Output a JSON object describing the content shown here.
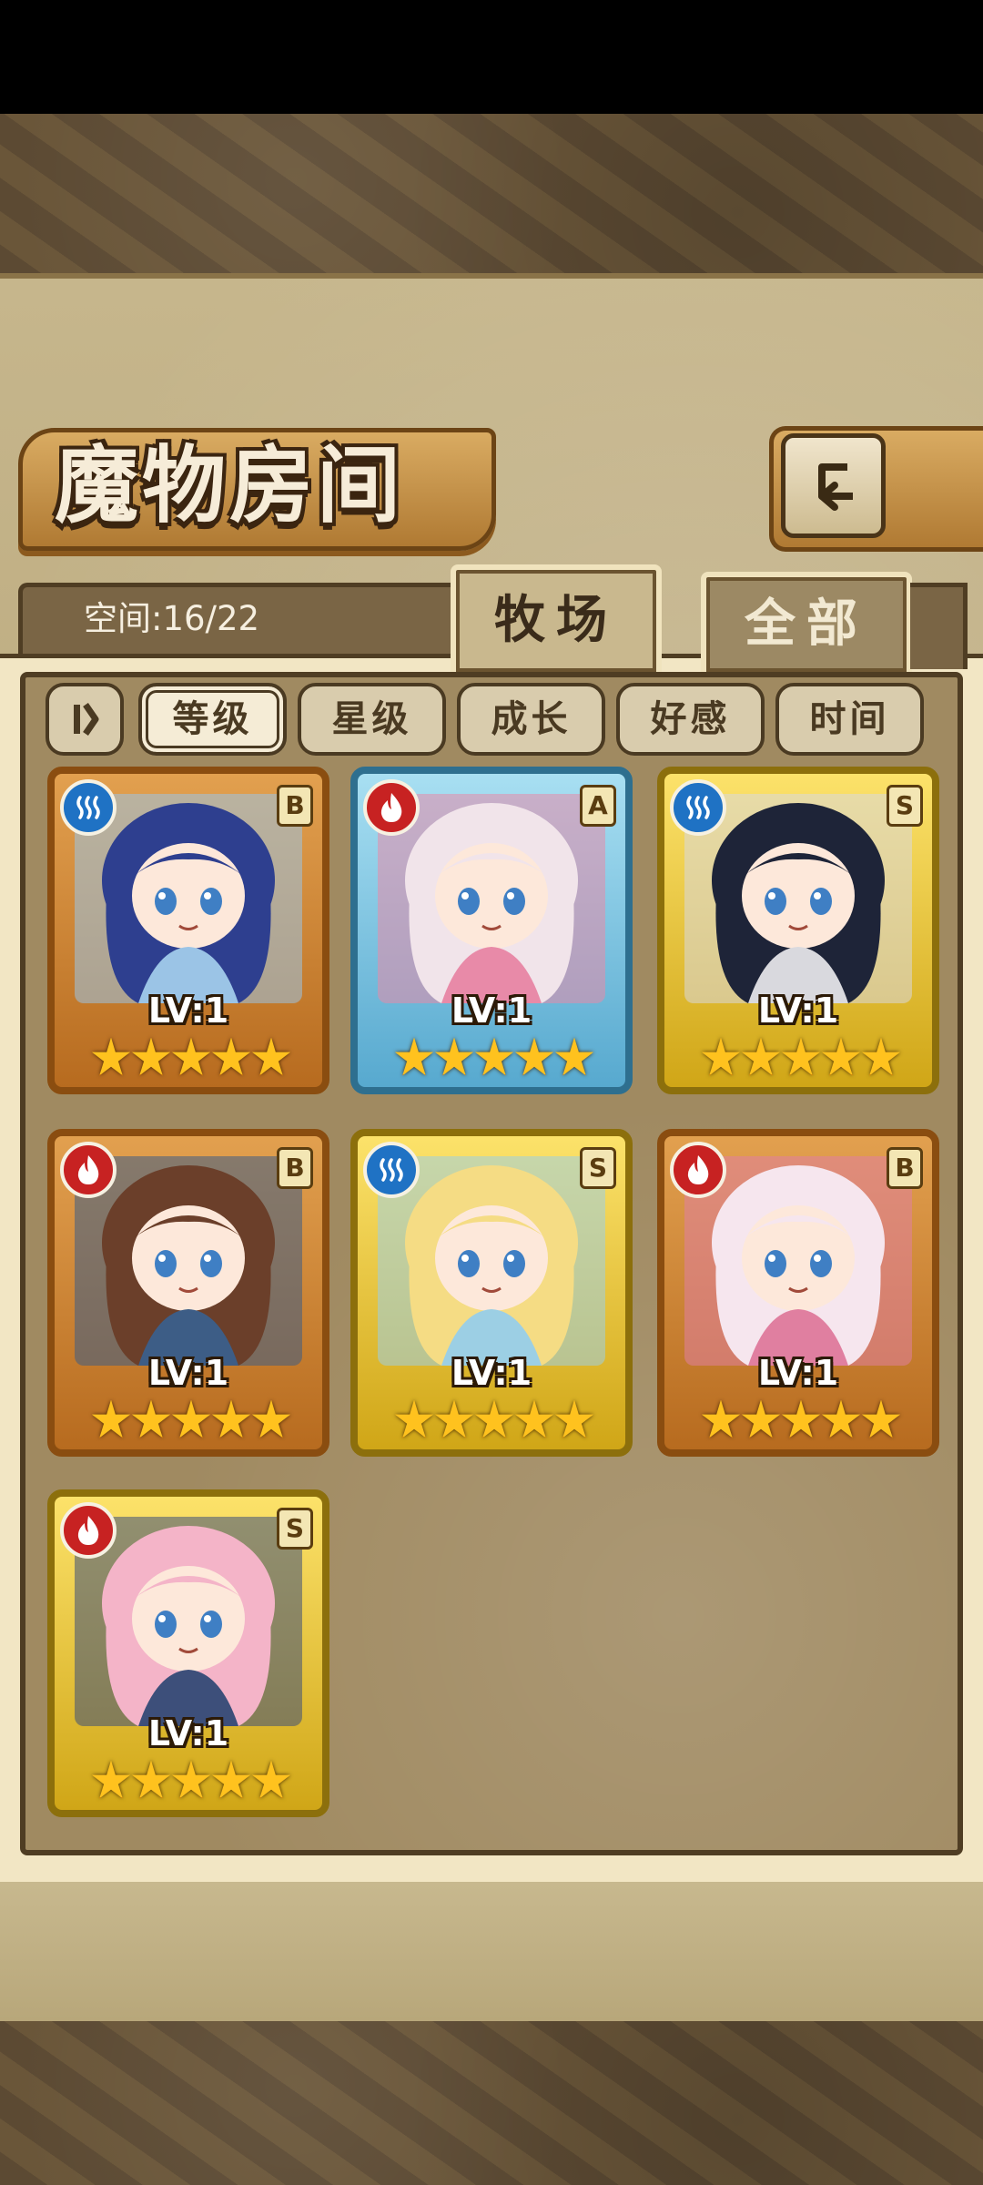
{
  "header": {
    "title": "魔物房间",
    "back_icon": "back-arrow-icon"
  },
  "storage": {
    "label": "空间:16/22"
  },
  "tabs": [
    {
      "label": "牧场",
      "active": true
    },
    {
      "label": "全部",
      "active": false
    }
  ],
  "sort": {
    "toggle_icon": "sort-order-icon",
    "buttons": [
      {
        "label": "等级",
        "active": true
      },
      {
        "label": "星级",
        "active": false
      },
      {
        "label": "成长",
        "active": false
      },
      {
        "label": "好感",
        "active": false
      },
      {
        "label": "时间",
        "active": false
      }
    ]
  },
  "monsters": [
    {
      "element": "water",
      "rank": "B",
      "level": "LV:1",
      "stars": 5,
      "frame": "orange",
      "hair": "#2e3f8f",
      "accent": "#9bc4e6"
    },
    {
      "element": "fire",
      "rank": "A",
      "level": "LV:1",
      "stars": 5,
      "frame": "blue",
      "hair": "#f1e4ea",
      "accent": "#e88aa8"
    },
    {
      "element": "water",
      "rank": "S",
      "level": "LV:1",
      "stars": 5,
      "frame": "gold",
      "hair": "#1e2438",
      "accent": "#d9d9de"
    },
    {
      "element": "fire",
      "rank": "B",
      "level": "LV:1",
      "stars": 5,
      "frame": "orange",
      "hair": "#6b3f2a",
      "accent": "#3d5d86"
    },
    {
      "element": "water",
      "rank": "S",
      "level": "LV:1",
      "stars": 5,
      "frame": "gold",
      "hair": "#f5dc84",
      "accent": "#9ccfe4"
    },
    {
      "element": "fire",
      "rank": "B",
      "level": "LV:1",
      "stars": 5,
      "frame": "orange",
      "hair": "#f6e6ee",
      "accent": "#e07fa0"
    },
    {
      "element": "fire",
      "rank": "S",
      "level": "LV:1",
      "stars": 5,
      "frame": "gold",
      "hair": "#f4b4c8",
      "accent": "#3d4f7a"
    }
  ]
}
